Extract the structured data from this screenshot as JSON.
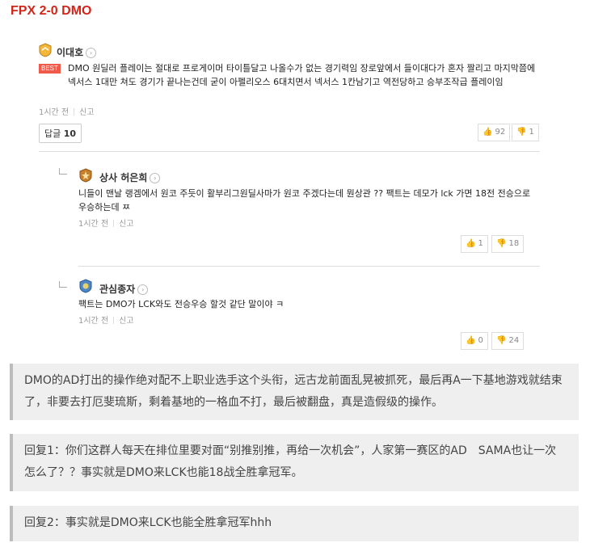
{
  "header": {
    "title": "FPX 2-0 DMO"
  },
  "screenshot": {
    "main_comment": {
      "author": "이대호",
      "best_label": "BEST",
      "text": "DMO 원딜러 플레이는 절대로 프로게이머 타이틀달고 나올수가 없는 경기력임 장로앞에서 들이대다가 혼자 짤리고 마지막쯤에 넥서스 1대만 쳐도 경기가 끝나는건데 굳이 아펠리오스 6대치면서 넥서스 1칸남기고 역전당하고 승부조작급 플레이임",
      "time": "1시간 전",
      "report": "신고",
      "reply_label": "답글",
      "reply_count": "10",
      "likes": "92",
      "dislikes": "1"
    },
    "replies": [
      {
        "author": "상사 허은희",
        "text": "니들이 맨날 랭겜에서 원코 주듯이 활부리그원딜사마가 원코 주겠다는데 뭔상관 ?? 팩트는 데모가 lck 가면 18전 전승으로 우승하는데 ㅉ",
        "time": "1시간 전",
        "report": "신고",
        "likes": "1",
        "dislikes": "18"
      },
      {
        "author": "관심종자",
        "text": "팩트는 DMO가 LCK와도 전승우승 할것 같단 말이야 ㅋ",
        "time": "1시간 전",
        "report": "신고",
        "likes": "0",
        "dislikes": "24"
      }
    ]
  },
  "quotes": [
    "DMO的AD打出的操作绝对配不上职业选手这个头衔，远古龙前面乱晃被抓死，最后再A一下基地游戏就结束了，非要去打厄斐琉斯，剩着基地的一格血不打，最后被翻盘，真是造假级的操作。",
    "回复1：你们这群人每天在排位里要对面“别推别推，再给一次机会”，人家第一赛区的AD　SAMA也让一次怎么了？？事实就是DMO来LCK也能18战全胜拿冠军。",
    "回复2：事实就是DMO来LCK也能全胜拿冠军hhh"
  ],
  "colors": {
    "title": "#d0261a",
    "best": "#ef5a4b",
    "quote_bg": "#efefef",
    "quote_bar": "#bdbdbd"
  },
  "icons": {
    "like": "thumbs-up-icon",
    "dislike": "thumbs-down-icon",
    "badge": "rank-badge-icon"
  }
}
